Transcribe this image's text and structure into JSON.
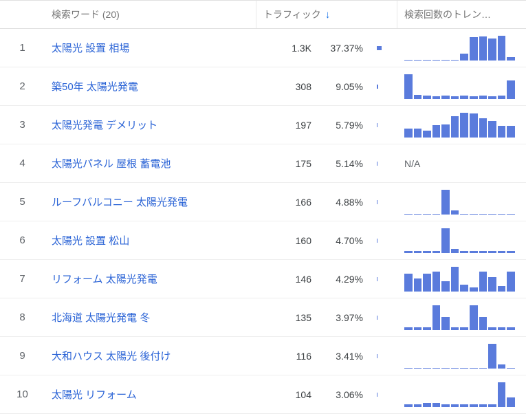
{
  "header": {
    "keywords_label": "検索ワード (20)",
    "traffic_label": "トラフィック",
    "trend_label": "検索回数のトレン…"
  },
  "rows": [
    {
      "rank": "1",
      "keyword": "太陽光 設置 相場",
      "traffic": "1.3K",
      "pct": "37.37%",
      "bar_pct": 37.37,
      "trend": [
        0,
        0,
        0,
        0,
        0,
        0,
        22,
        86,
        90,
        82,
        94,
        8
      ],
      "na": false
    },
    {
      "rank": "2",
      "keyword": "築50年 太陽光発電",
      "traffic": "308",
      "pct": "9.05%",
      "bar_pct": 9.05,
      "trend": [
        70,
        8,
        6,
        4,
        6,
        4,
        6,
        4,
        6,
        4,
        6,
        50
      ],
      "na": false
    },
    {
      "rank": "3",
      "keyword": "太陽光発電 デメリット",
      "traffic": "197",
      "pct": "5.79%",
      "bar_pct": 5.79,
      "trend": [
        30,
        30,
        22,
        42,
        46,
        80,
        95,
        90,
        70,
        60,
        40,
        40
      ],
      "na": false
    },
    {
      "rank": "4",
      "keyword": "太陽光パネル 屋根 蓄電池",
      "traffic": "175",
      "pct": "5.14%",
      "bar_pct": 5.14,
      "trend": null,
      "na": true
    },
    {
      "rank": "5",
      "keyword": "ルーフバルコニー 太陽光発電",
      "traffic": "166",
      "pct": "4.88%",
      "bar_pct": 4.88,
      "trend": [
        0,
        0,
        0,
        0,
        90,
        8,
        0,
        0,
        0,
        0,
        0,
        0
      ],
      "na": false
    },
    {
      "rank": "6",
      "keyword": "太陽光 設置 松山",
      "traffic": "160",
      "pct": "4.70%",
      "bar_pct": 4.7,
      "trend": [
        2,
        2,
        2,
        2,
        90,
        8,
        2,
        2,
        2,
        2,
        2,
        2
      ],
      "na": false
    },
    {
      "rank": "7",
      "keyword": "リフォーム 太陽光発電",
      "traffic": "146",
      "pct": "4.29%",
      "bar_pct": 4.29,
      "trend": [
        62,
        44,
        62,
        70,
        34,
        90,
        20,
        10,
        70,
        50,
        14,
        70
      ],
      "na": false
    },
    {
      "rank": "8",
      "keyword": "北海道 太陽光発電 冬",
      "traffic": "135",
      "pct": "3.97%",
      "bar_pct": 3.97,
      "trend": [
        2,
        2,
        2,
        60,
        30,
        2,
        2,
        60,
        30,
        2,
        2,
        2
      ],
      "na": false
    },
    {
      "rank": "9",
      "keyword": "大和ハウス 太陽光 後付け",
      "traffic": "116",
      "pct": "3.41%",
      "bar_pct": 3.41,
      "trend": [
        0,
        0,
        0,
        0,
        0,
        0,
        0,
        0,
        0,
        90,
        8,
        0
      ],
      "na": false
    },
    {
      "rank": "10",
      "keyword": "太陽光 リフォーム",
      "traffic": "104",
      "pct": "3.06%",
      "bar_pct": 3.06,
      "trend": [
        4,
        4,
        8,
        8,
        4,
        4,
        4,
        4,
        4,
        4,
        90,
        30
      ],
      "na": false
    }
  ],
  "na_label": "N/A",
  "chart_data": {
    "type": "table",
    "title": "検索ワード トラフィック",
    "columns": [
      "rank",
      "keyword",
      "traffic",
      "percentage"
    ],
    "rows": [
      [
        1,
        "太陽光 設置 相場",
        "1.3K",
        "37.37%"
      ],
      [
        2,
        "築50年 太陽光発電",
        "308",
        "9.05%"
      ],
      [
        3,
        "太陽光発電 デメリット",
        "197",
        "5.79%"
      ],
      [
        4,
        "太陽光パネル 屋根 蓄電池",
        "175",
        "5.14%"
      ],
      [
        5,
        "ルーフバルコニー 太陽光発電",
        "166",
        "4.88%"
      ],
      [
        6,
        "太陽光 設置 松山",
        "160",
        "4.70%"
      ],
      [
        7,
        "リフォーム 太陽光発電",
        "146",
        "4.29%"
      ],
      [
        8,
        "北海道 太陽光発電 冬",
        "135",
        "3.97%"
      ],
      [
        9,
        "大和ハウス 太陽光 後付け",
        "116",
        "3.41%"
      ],
      [
        10,
        "太陽光 リフォーム",
        "104",
        "3.06%"
      ]
    ],
    "trend_sparklines": "relative heights 0-100, 12 periods each; row 4 trend is N/A"
  }
}
